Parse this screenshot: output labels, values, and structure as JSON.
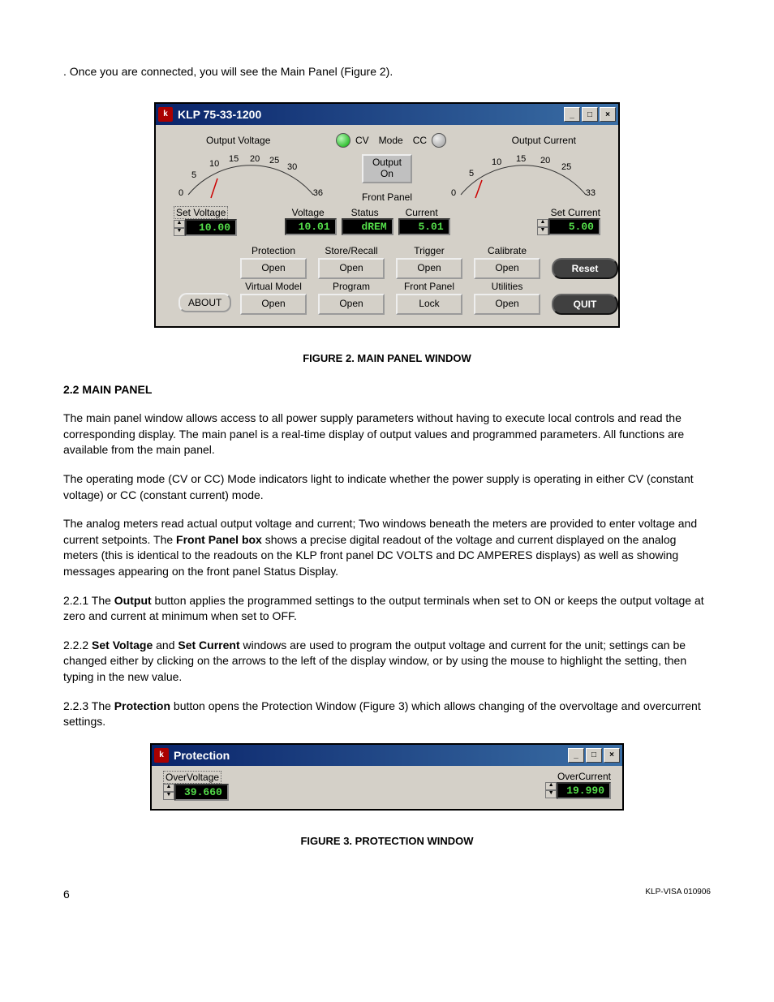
{
  "intro_text": ". Once you are connected, you will see the Main Panel (Figure 2).",
  "figure2": {
    "title": "KLP 75-33-1200",
    "output_voltage_label": "Output Voltage",
    "output_current_label": "Output Current",
    "cv_label": "CV",
    "mode_label": "Mode",
    "cc_label": "CC",
    "output_box_line1": "Output",
    "output_box_line2": "On",
    "front_panel_label": "Front Panel",
    "voltage_meter": {
      "ticks": [
        "0",
        "5",
        "10",
        "15",
        "20",
        "25",
        "30",
        "36"
      ]
    },
    "current_meter": {
      "ticks": [
        "0",
        "5",
        "10",
        "15",
        "20",
        "25",
        "33"
      ]
    },
    "set_voltage_label": "Set Voltage",
    "set_voltage_value": "10.00",
    "fp_voltage_label": "Voltage",
    "fp_voltage_value": "10.01",
    "fp_status_label": "Status",
    "fp_status_value": "dREM",
    "fp_current_label": "Current",
    "fp_current_value": "5.01",
    "set_current_label": "Set Current",
    "set_current_value": "5.00",
    "cols": {
      "protection": "Protection",
      "store_recall": "Store/Recall",
      "trigger": "Trigger",
      "calibrate": "Calibrate",
      "virtual_model": "Virtual Model",
      "program": "Program",
      "front_panel": "Front Panel",
      "utilities": "Utilities"
    },
    "btn_open": "Open",
    "btn_lock": "Lock",
    "btn_reset": "Reset",
    "btn_about": "ABOUT",
    "btn_quit": "QUIT",
    "win_min": "_",
    "win_max": "□",
    "win_close": "×"
  },
  "caption2": "FIGURE 2.    MAIN PANEL WINDOW",
  "sec22_num": "2.2",
  "sec22_title": "  MAIN PANEL",
  "para1": "The main panel window allows access to all power supply parameters without having to execute local controls and read the corresponding display. The main panel is a real-time display of output values and programmed parameters. All functions are available from the main panel.",
  "para2": "The operating mode (CV or CC) Mode indicators light to indicate whether the power supply is operating in either CV (constant voltage) or CC (constant current) mode.",
  "para3_a": "The analog meters read actual output voltage and current; Two windows beneath the meters are provided to enter voltage and current setpoints. The ",
  "para3_bold": "Front Panel box",
  "para3_b": " shows a precise digital readout of the voltage and current displayed on the analog meters (this is identical to the readouts on the KLP front panel DC VOLTS and DC AMPERES displays) as well as showing messages appearing on the front panel Status Display.",
  "para221_a": "2.2.1   The ",
  "para221_bold": "Output",
  "para221_b": " button applies the programmed settings to the output terminals when set to ON or keeps the output voltage at zero and current at minimum when set to OFF.",
  "para222_a": "2.2.2   ",
  "para222_bold1": "Set Voltage",
  "para222_mid": " and ",
  "para222_bold2": "Set Current",
  "para222_b": " windows are used to program the output voltage and current for the unit; settings can be changed either by clicking on the arrows to the left of the display window, or by using the mouse to highlight the setting, then typing in the new value.",
  "para223_a": "2.2.3   The ",
  "para223_bold": "Protection",
  "para223_b": " button opens the Protection Window (Figure 3) which allows changing of the overvoltage and overcurrent settings.",
  "figure3": {
    "title": "Protection",
    "ov_label": "OverVoltage",
    "ov_value": "39.660",
    "oc_label": "OverCurrent",
    "oc_value": "19.990"
  },
  "caption3": "FIGURE 3.    PROTECTION WINDOW",
  "footer_page": "6",
  "footer_doc": "KLP-VISA 010906"
}
